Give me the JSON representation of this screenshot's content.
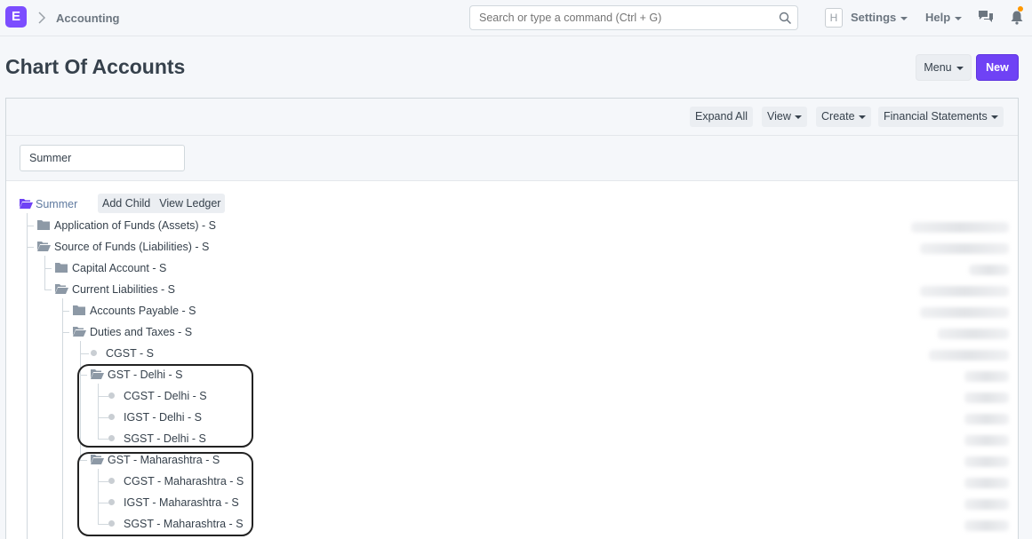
{
  "navbar": {
    "logo": "E",
    "breadcrumb": "Accounting",
    "search_placeholder": "Search or type a command (Ctrl + G)",
    "avatar": "H",
    "settings_label": "Settings",
    "help_label": "Help",
    "colors": {
      "brand": "#7c4dff",
      "notification": "#ff9800"
    }
  },
  "page": {
    "title": "Chart Of Accounts",
    "menu_label": "Menu",
    "new_label": "New",
    "colors": {
      "primary": "#6f42f5"
    }
  },
  "toolbar": {
    "expand_all": "Expand All",
    "view": "View",
    "create": "Create",
    "financial_statements": "Financial Statements"
  },
  "filter": {
    "company": "Summer"
  },
  "tree": {
    "root": {
      "label": "Summer",
      "add_child": "Add Child",
      "view_ledger": "View Ledger"
    },
    "nodes": [
      {
        "label": "Application of Funds (Assets) - S",
        "type": "folder-closed",
        "depth": 1
      },
      {
        "label": "Source of Funds (Liabilities) - S",
        "type": "folder-open",
        "depth": 1
      },
      {
        "label": "Capital Account - S",
        "type": "folder-closed",
        "depth": 2
      },
      {
        "label": "Current Liabilities - S",
        "type": "folder-open",
        "depth": 2
      },
      {
        "label": "Accounts Payable - S",
        "type": "folder-closed",
        "depth": 3
      },
      {
        "label": "Duties and Taxes - S",
        "type": "folder-open",
        "depth": 3
      },
      {
        "label": "CGST - S",
        "type": "leaf",
        "depth": 4
      },
      {
        "label": "GST - Delhi - S",
        "type": "folder-open",
        "depth": 4
      },
      {
        "label": "CGST - Delhi - S",
        "type": "leaf",
        "depth": 5
      },
      {
        "label": "IGST - Delhi - S",
        "type": "leaf",
        "depth": 5
      },
      {
        "label": "SGST - Delhi - S",
        "type": "leaf",
        "depth": 5
      },
      {
        "label": "GST - Maharashtra - S",
        "type": "folder-open",
        "depth": 4
      },
      {
        "label": "CGST - Maharashtra - S",
        "type": "leaf",
        "depth": 5
      },
      {
        "label": "IGST - Maharashtra - S",
        "type": "leaf",
        "depth": 5
      },
      {
        "label": "SGST - Maharashtra - S",
        "type": "leaf",
        "depth": 5
      }
    ]
  }
}
